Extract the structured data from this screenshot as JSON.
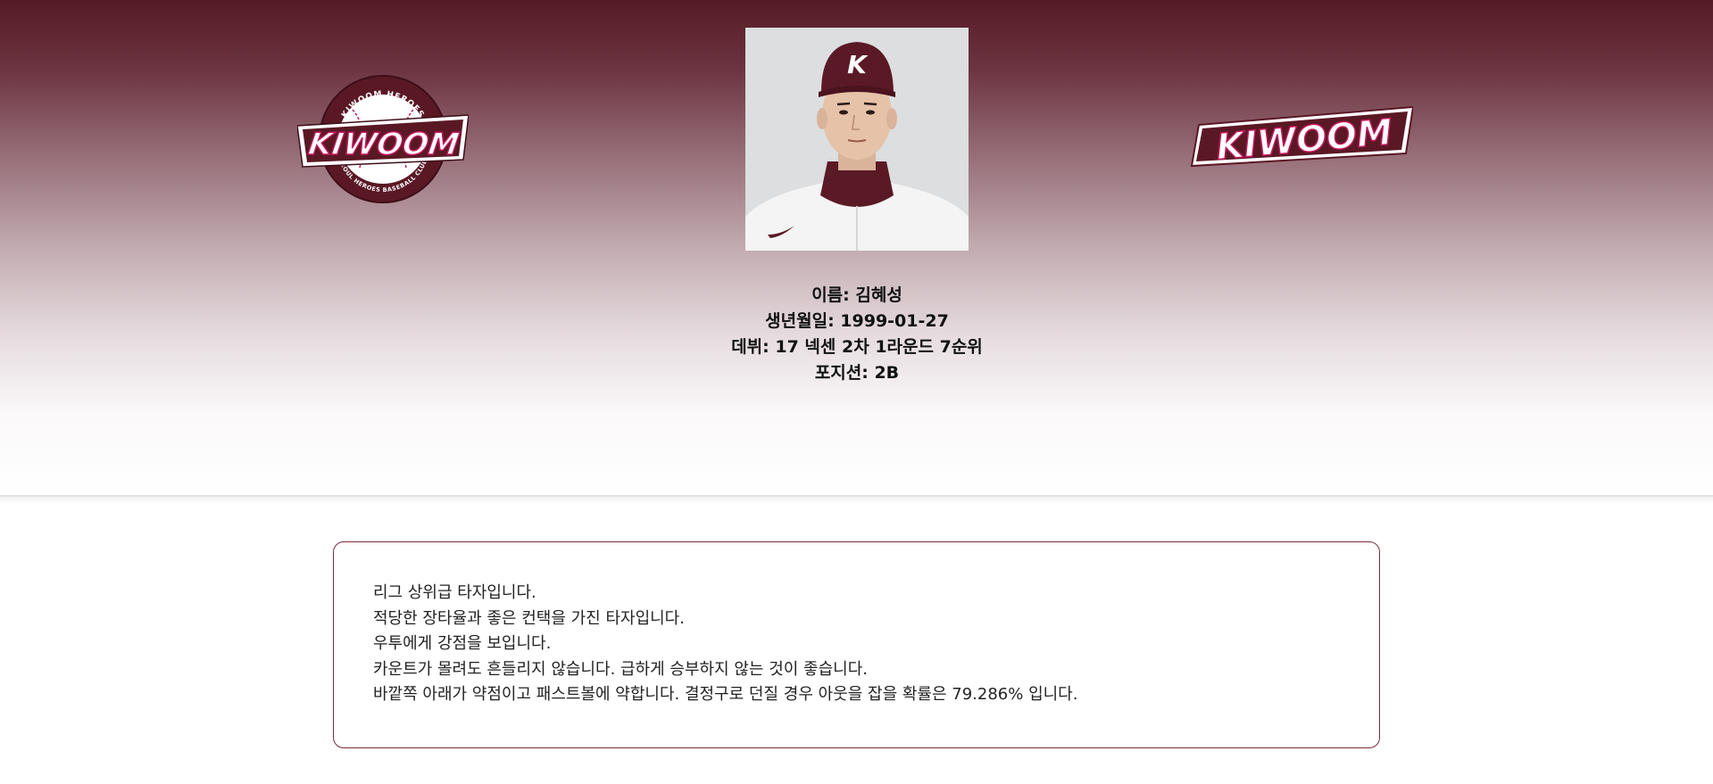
{
  "colors": {
    "brand_burgundy": "#551b25",
    "logo_pink": "#c2185b",
    "border": "#7b2d3e"
  },
  "header": {
    "logo_left": {
      "icon": "kiwoom-heroes-emblem-icon",
      "wordmark": "KIWOOM",
      "top_text": "KIWOOM HEROES",
      "bottom_text": "SEOUL HEROES BASEBALL CLUB"
    },
    "logo_right": {
      "icon": "kiwoom-wordmark-icon",
      "wordmark": "KIWOOM"
    },
    "player_photo": {
      "icon": "player-photo",
      "cap_letter": "K"
    }
  },
  "player": {
    "name_line": "이름: 김혜성",
    "birth_line": "생년월일: 1999-01-27",
    "debut_line": "데뷔: 17 넥센 2차 1라운드 7순위",
    "position_line": "포지션: 2B"
  },
  "report": {
    "lines": [
      "리그 상위급 타자입니다.",
      "적당한 장타율과 좋은 컨택을 가진 타자입니다.",
      "우투에게 강점을 보입니다.",
      "카운트가 몰려도 흔들리지 않습니다. 급하게 승부하지 않는 것이 좋습니다.",
      "바깥쪽 아래가 약점이고 패스트볼에 약합니다. 결정구로 던질 경우 아웃을 잡을 확률은 79.286% 입니다."
    ]
  }
}
